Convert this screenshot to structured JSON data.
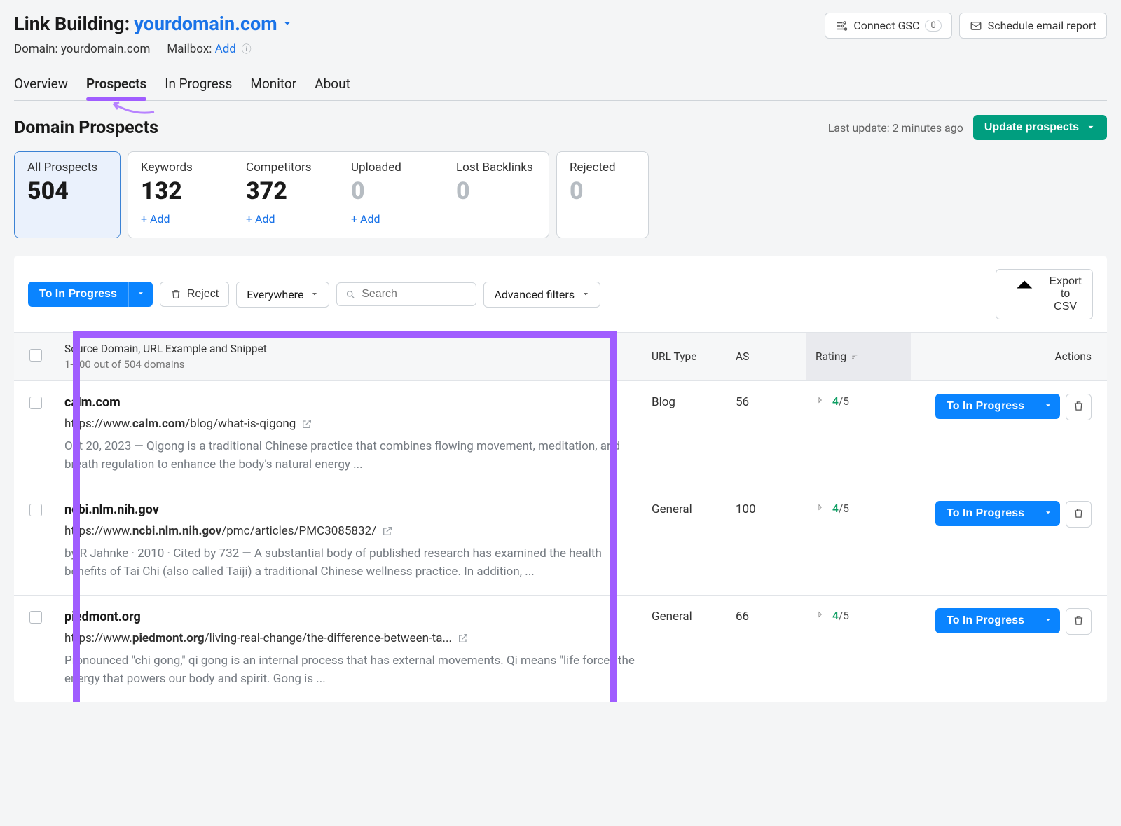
{
  "header": {
    "title_prefix": "Link Building:",
    "domain": "yourdomain.com",
    "domain_label": "Domain: yourdomain.com",
    "mailbox_label": "Mailbox:",
    "mailbox_add": "Add",
    "connect_gsc_label": "Connect GSC",
    "connect_gsc_badge": "0",
    "schedule_label": "Schedule email report"
  },
  "tabs": {
    "overview": "Overview",
    "prospects": "Prospects",
    "in_progress": "In Progress",
    "monitor": "Monitor",
    "about": "About"
  },
  "section": {
    "title": "Domain Prospects",
    "last_update": "Last update: 2 minutes ago",
    "update_button": "Update prospects"
  },
  "stats": {
    "all_prospects": {
      "label": "All Prospects",
      "value": "504"
    },
    "keywords": {
      "label": "Keywords",
      "value": "132",
      "add": "+ Add"
    },
    "competitors": {
      "label": "Competitors",
      "value": "372",
      "add": "+ Add"
    },
    "uploaded": {
      "label": "Uploaded",
      "value": "0",
      "add": "+ Add"
    },
    "lost": {
      "label": "Lost Backlinks",
      "value": "0"
    },
    "rejected": {
      "label": "Rejected",
      "value": "0"
    }
  },
  "toolbar": {
    "to_in_progress": "To In Progress",
    "reject": "Reject",
    "scope": "Everywhere",
    "search_placeholder": "Search",
    "advanced_filters": "Advanced filters",
    "export": "Export to CSV"
  },
  "table": {
    "th_title": "Source Domain, URL Example and Snippet",
    "th_sub": "1-100 out of 504 domains",
    "th_url_type": "URL Type",
    "th_as": "AS",
    "th_rating": "Rating",
    "th_actions": "Actions",
    "row_action": "To In Progress"
  },
  "rows": [
    {
      "domain": "calm.com",
      "url_pre": "https://www.",
      "url_bold": "calm.com",
      "url_post": "/blog/what-is-qigong",
      "snippet": "Oct 20, 2023 — Qigong is a traditional Chinese practice that combines flowing movement, meditation, and breath regulation to enhance the body's natural energy ...",
      "url_type": "Blog",
      "as": "56",
      "rating_val": "4",
      "rating_of": "/5"
    },
    {
      "domain": "ncbi.nlm.nih.gov",
      "url_pre": "https://www.",
      "url_bold": "ncbi.nlm.nih.gov",
      "url_post": "/pmc/articles/PMC3085832/",
      "snippet": "by R Jahnke · 2010 · Cited by 732 — A substantial body of published research has examined the health benefits of Tai Chi (also called Taiji) a traditional Chinese wellness practice. In addition, ...",
      "url_type": "General",
      "as": "100",
      "rating_val": "4",
      "rating_of": "/5"
    },
    {
      "domain": "piedmont.org",
      "url_pre": "https://www.",
      "url_bold": "piedmont.org",
      "url_post": "/living-real-change/the-difference-between-ta...",
      "snippet": "Pronounced \"chi gong,\" qi gong is an internal process that has external movements. Qi means \"life force,\" the energy that powers our body and spirit. Gong is ...",
      "url_type": "General",
      "as": "66",
      "rating_val": "4",
      "rating_of": "/5"
    }
  ]
}
